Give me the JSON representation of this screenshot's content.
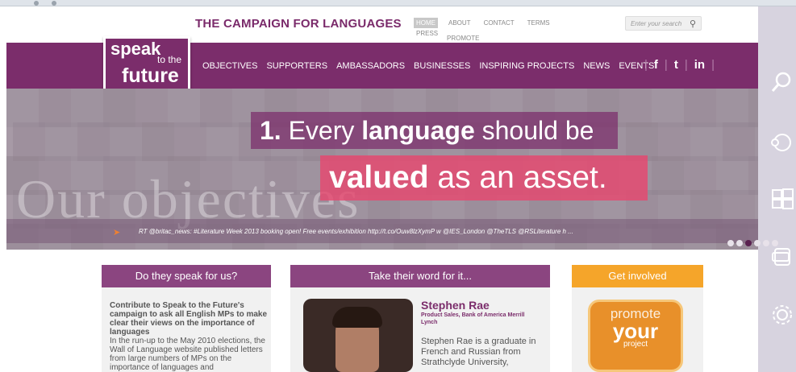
{
  "site": {
    "brand": "THE CAMPAIGN FOR LANGUAGES",
    "util_links": [
      "HOME",
      "ABOUT",
      "CONTACT",
      "TERMS",
      "PRESS"
    ],
    "util_promote": "PROMOTE",
    "search_placeholder": "Enter your search",
    "search_icon": "magnifier-icon"
  },
  "logo": {
    "line1": "speak",
    "line2": "to the",
    "line3": "future"
  },
  "nav": {
    "items": [
      "OBJECTIVES",
      "SUPPORTERS",
      "AMBASSADORS",
      "BUSINESSES",
      "INSPIRING PROJECTS",
      "NEWS",
      "EVENTS"
    ],
    "social": [
      "f",
      "t",
      "in"
    ]
  },
  "hero": {
    "line1_num": "1.",
    "line1_pre": "Every",
    "line1_bold": "language",
    "line1_post": "should be",
    "line2_bold": "valued",
    "line2_post": "as an asset.",
    "watermark": "Our objectives",
    "tweet": "RT @britac_news: #Literature Week 2013 booking open! Free events/exhibition http://t.co/Ouw8lzXymP w @IES_London @TheTLS @RSLiterature h ...",
    "slides_total": 6,
    "slide_active": 3
  },
  "cards": {
    "c1": {
      "title": "Do they speak for us?",
      "bold": "Contribute to Speak to the Future's campaign to ask all English MPs to make clear their views on the importance of languages",
      "body": "In the run-up to the May 2010 elections, the Wall of Language website published letters from large numbers of MPs on the importance of languages and"
    },
    "c2": {
      "title": "Take their word for it...",
      "name": "Stephen Rae",
      "role": "Product Sales, Bank of America Merrill Lynch",
      "bio": "Stephen Rae is a graduate in French and Russian from Strathclyde University,"
    },
    "c3": {
      "title": "Get involved",
      "promo1": "promote",
      "promo2": "your",
      "promo3": "project"
    }
  },
  "colors": {
    "purple": "#7b2d6b",
    "orange": "#f5a52a",
    "pink": "#e8466e"
  }
}
